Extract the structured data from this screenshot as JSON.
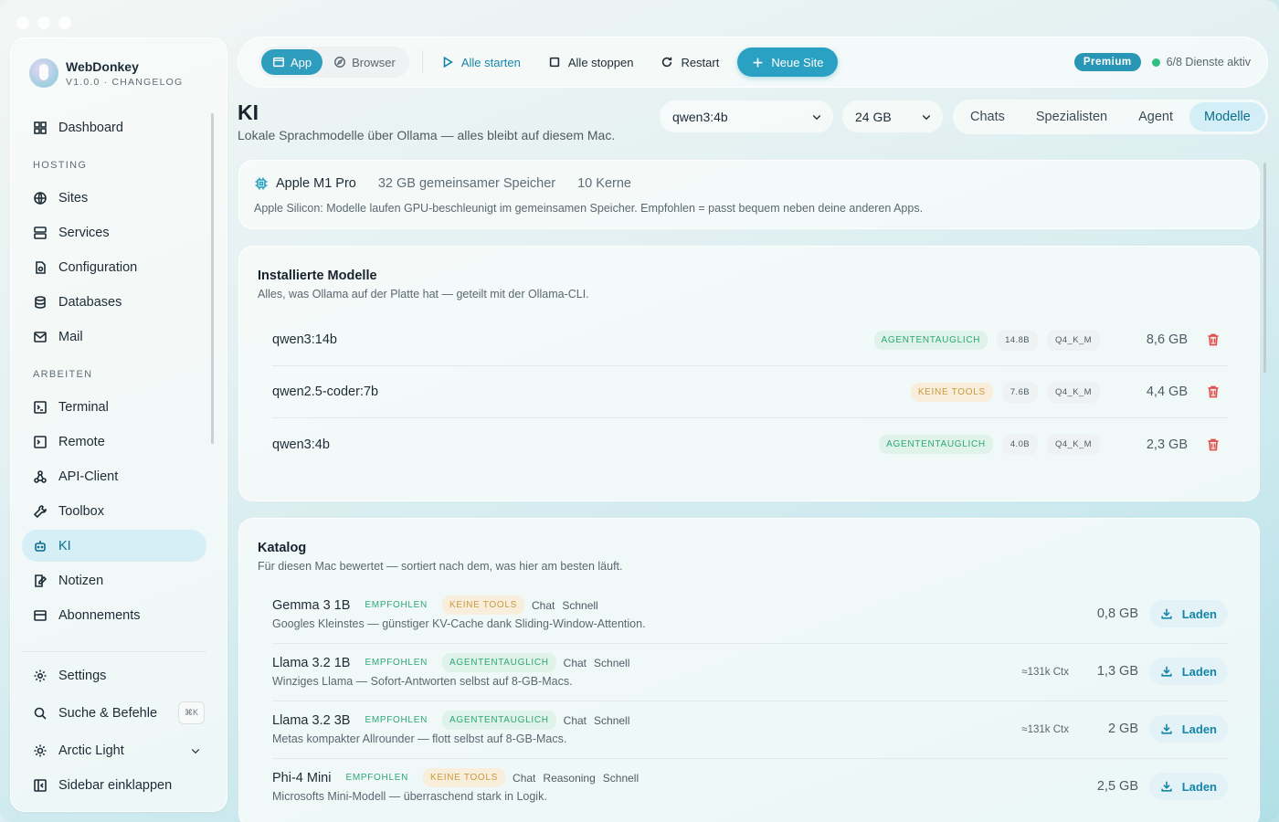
{
  "app": {
    "name": "WebDonkey",
    "version": "V1.0.0 · CHANGELOG"
  },
  "sidebar": {
    "dashboard": "Dashboard",
    "section_hosting": "HOSTING",
    "hosting": [
      "Sites",
      "Services",
      "Configuration",
      "Databases",
      "Mail"
    ],
    "section_arbeiten": "ARBEITEN",
    "arbeiten": [
      "Terminal",
      "Remote",
      "API-Client",
      "Toolbox",
      "KI",
      "Notizen",
      "Abonnements"
    ],
    "active": "KI",
    "settings": "Settings",
    "search": "Suche & Befehle",
    "search_shortcut": "⌘K",
    "theme": "Arctic Light",
    "collapse": "Sidebar einklappen"
  },
  "toolbar": {
    "mode_app": "App",
    "mode_browser": "Browser",
    "start_all": "Alle starten",
    "stop_all": "Alle stoppen",
    "restart": "Restart",
    "new_site": "Neue Site",
    "premium": "Premium",
    "status": "6/8 Dienste aktiv"
  },
  "header": {
    "title": "KI",
    "subtitle": "Lokale Sprachmodelle über Ollama — alles bleibt auf diesem Mac.",
    "model_select": "qwen3:4b",
    "memory_select": "24 GB",
    "tabs": [
      "Chats",
      "Spezialisten",
      "Agent",
      "Modelle"
    ],
    "active_tab": "Modelle"
  },
  "hardware": {
    "chip": "Apple M1 Pro",
    "memory": "32 GB gemeinsamer Speicher",
    "cores": "10 Kerne",
    "note": "Apple Silicon: Modelle laufen GPU-beschleunigt im gemeinsamen Speicher. Empfohlen = passt bequem neben deine anderen Apps."
  },
  "installed": {
    "title": "Installierte Modelle",
    "subtitle": "Alles, was Ollama auf der Platte hat — geteilt mit der Ollama-CLI.",
    "models": [
      {
        "name": "qwen3:14b",
        "badge": "AGENTENTAUGLICH",
        "badge_type": "green",
        "params": "14.8B",
        "quant": "Q4_K_M",
        "size": "8,6 GB"
      },
      {
        "name": "qwen2.5-coder:7b",
        "badge": "KEINE TOOLS",
        "badge_type": "amber",
        "params": "7.6B",
        "quant": "Q4_K_M",
        "size": "4,4 GB"
      },
      {
        "name": "qwen3:4b",
        "badge": "AGENTENTAUGLICH",
        "badge_type": "green",
        "params": "4.0B",
        "quant": "Q4_K_M",
        "size": "2,3 GB"
      }
    ]
  },
  "catalog": {
    "title": "Katalog",
    "subtitle": "Für diesen Mac bewertet — sortiert nach dem, was hier am besten läuft.",
    "load_label": "Laden",
    "models": [
      {
        "name": "Gemma 3 1B",
        "rec": "EMPFOHLEN",
        "badge": "KEINE TOOLS",
        "badge_type": "amber",
        "tags": [
          "Chat",
          "Schnell"
        ],
        "desc": "Googles Kleinstes — günstiger KV-Cache dank Sliding-Window-Attention.",
        "ctx": "",
        "size": "0,8 GB"
      },
      {
        "name": "Llama 3.2 1B",
        "rec": "EMPFOHLEN",
        "badge": "AGENTENTAUGLICH",
        "badge_type": "green",
        "tags": [
          "Chat",
          "Schnell"
        ],
        "desc": "Winziges Llama — Sofort-Antworten selbst auf 8-GB-Macs.",
        "ctx": "≈131k Ctx",
        "size": "1,3 GB"
      },
      {
        "name": "Llama 3.2 3B",
        "rec": "EMPFOHLEN",
        "badge": "AGENTENTAUGLICH",
        "badge_type": "green",
        "tags": [
          "Chat",
          "Schnell"
        ],
        "desc": "Metas kompakter Allrounder — flott selbst auf 8-GB-Macs.",
        "ctx": "≈131k Ctx",
        "size": "2 GB"
      },
      {
        "name": "Phi-4 Mini",
        "rec": "EMPFOHLEN",
        "badge": "KEINE TOOLS",
        "badge_type": "amber",
        "tags": [
          "Chat",
          "Reasoning",
          "Schnell"
        ],
        "desc": "Microsofts Mini-Modell — überraschend stark in Logik.",
        "ctx": "",
        "size": "2,5 GB"
      }
    ]
  },
  "colors": {
    "accent": "#2aa0c2",
    "green": "#2da77a",
    "amber": "#c89a3c",
    "danger": "#e0524f"
  }
}
